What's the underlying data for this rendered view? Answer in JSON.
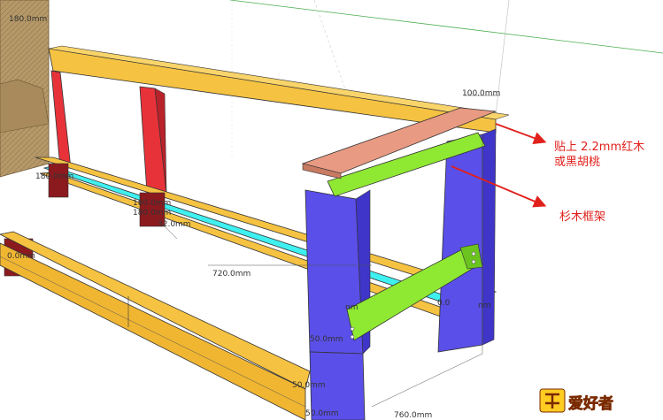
{
  "dimensions": {
    "d_100_top": "100.0mm",
    "d_180_a": "180.0mm",
    "d_180_b": "180.0mm",
    "d_180_c": "180.0mm",
    "d_32": "32.0mm",
    "d_720": "720.0mm",
    "d_760": "760.0mm",
    "d_50_mid": "50.0mm",
    "d_50_low": "50.0mm",
    "d_50_bot": "50.0mm",
    "d_0_right": "0.0",
    "d_nm_a": "nm",
    "d_nm_b": "nm",
    "d_bottom_left": "0.0mm",
    "d_top_left": "180.0mm"
  },
  "annotations": {
    "hardwood_top": "贴上 2.2mm红木\n或黑胡桃",
    "fir_frame": "杉木框架"
  },
  "colors": {
    "yellow_rail": "#f5c242",
    "red_post": "#e8323a",
    "blue_leg": "#5a4fe8",
    "green_rail": "#8fe832",
    "cyan_rail": "#3ff0f0",
    "top_board": "#e89a82",
    "sofa": "#b89a6a",
    "arrow": "#e0201b"
  },
  "logo": {
    "text": "木工爱好者",
    "icon": "woodworker-logo-icon"
  }
}
